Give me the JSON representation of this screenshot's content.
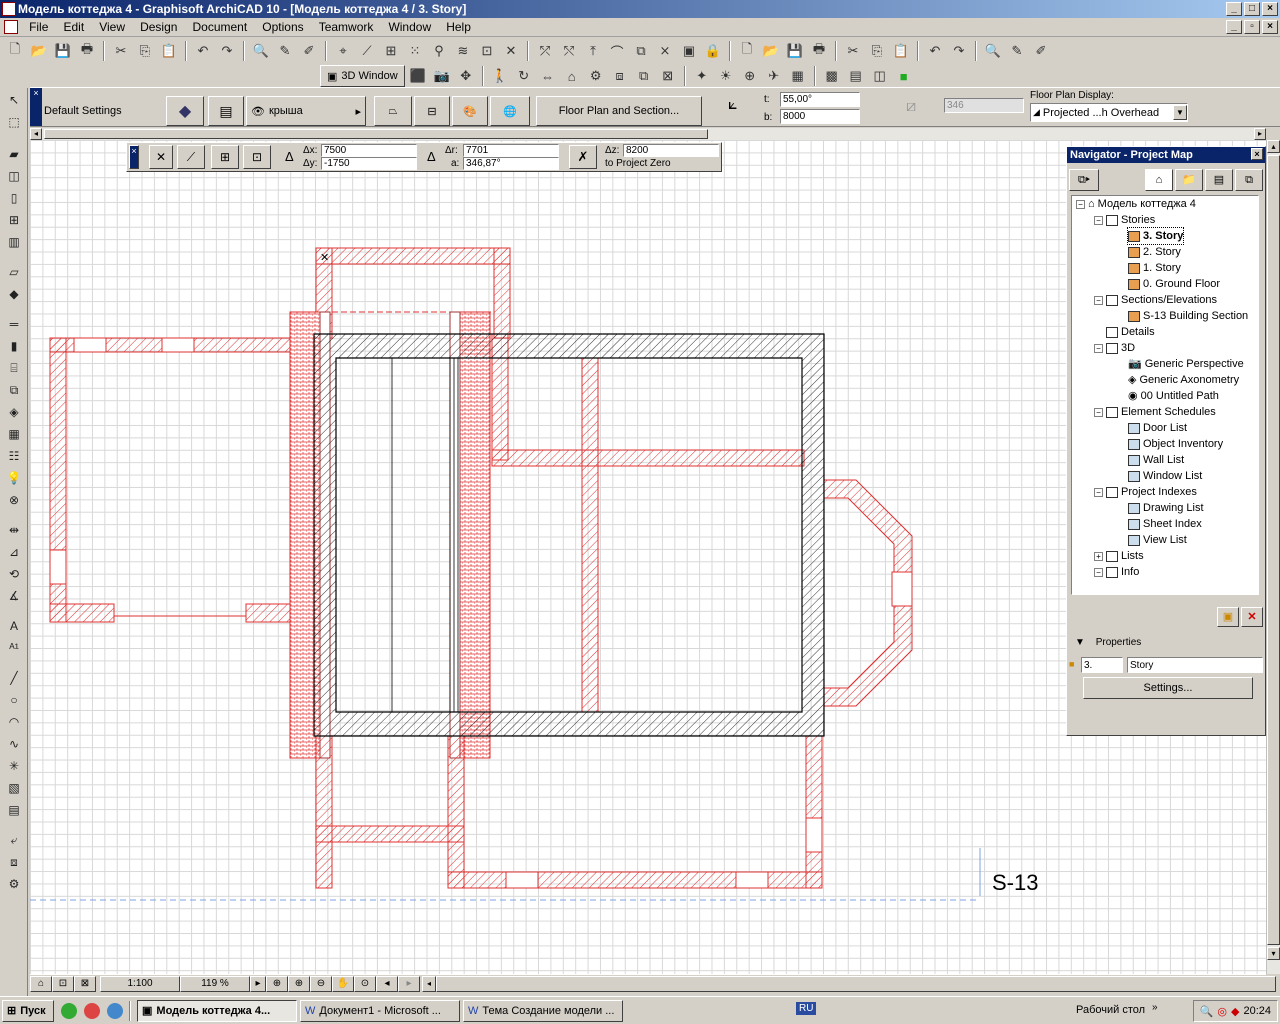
{
  "window": {
    "title": "Модель коттеджа 4 - Graphisoft ArchiCAD 10 - [Модель коттеджа 4 / 3. Story]"
  },
  "menu": [
    "File",
    "Edit",
    "View",
    "Design",
    "Document",
    "Options",
    "Teamwork",
    "Window",
    "Help"
  ],
  "toolbar2": {
    "window3d_label": "3D Window"
  },
  "infobox": {
    "default_settings": "Default Settings",
    "layer_name": "крыша",
    "floorplan_section_button": "Floor Plan and Section...",
    "t_label": "t:",
    "t_value": "55,00°",
    "b_label": "b:",
    "b_value": "8000",
    "disabled_value": "346",
    "floor_plan_display_label": "Floor Plan Display:",
    "floor_plan_display_value": "Projected ...h Overhead"
  },
  "coords": {
    "dx_label": "Δx:",
    "dx_value": "7500",
    "dy_label": "Δy:",
    "dy_value": "-1750",
    "dr_label": "Δr:",
    "dr_value": "7701",
    "a_label": "a:",
    "a_value": "346,87°",
    "dz_label": "Δz:",
    "dz_value": "8200",
    "project_zero": "to Project Zero"
  },
  "drawing": {
    "section_marker": "S-13",
    "plan_color": "#e03030"
  },
  "navigator": {
    "title": "Navigator - Project Map",
    "root": "Модель коттеджа 4",
    "stories_label": "Stories",
    "stories": [
      "3. Story",
      "2. Story",
      "1. Story",
      "0. Ground Floor"
    ],
    "sections_label": "Sections/Elevations",
    "sections": [
      "S-13 Building Section"
    ],
    "details_label": "Details",
    "threed_label": "3D",
    "threed_items": [
      "Generic Perspective",
      "Generic Axonometry",
      "00 Untitled Path"
    ],
    "schedules_label": "Element Schedules",
    "schedules": [
      "Door List",
      "Object Inventory",
      "Wall List",
      "Window List"
    ],
    "indexes_label": "Project Indexes",
    "indexes": [
      "Drawing List",
      "Sheet Index",
      "View List"
    ],
    "lists_label": "Lists",
    "info_label": "Info",
    "properties_label": "Properties",
    "prop_id": "3.",
    "prop_name": "Story",
    "settings_button": "Settings..."
  },
  "status": {
    "scale": "1:100",
    "zoom": "119 %"
  },
  "taskbar": {
    "start": "Пуск",
    "tasks": [
      "Модель коттеджа 4...",
      "Документ1 - Microsoft ...",
      "Тема Создание модели ..."
    ],
    "lang": "RU",
    "desktop": "Рабочий стол",
    "clock": "20:24"
  }
}
